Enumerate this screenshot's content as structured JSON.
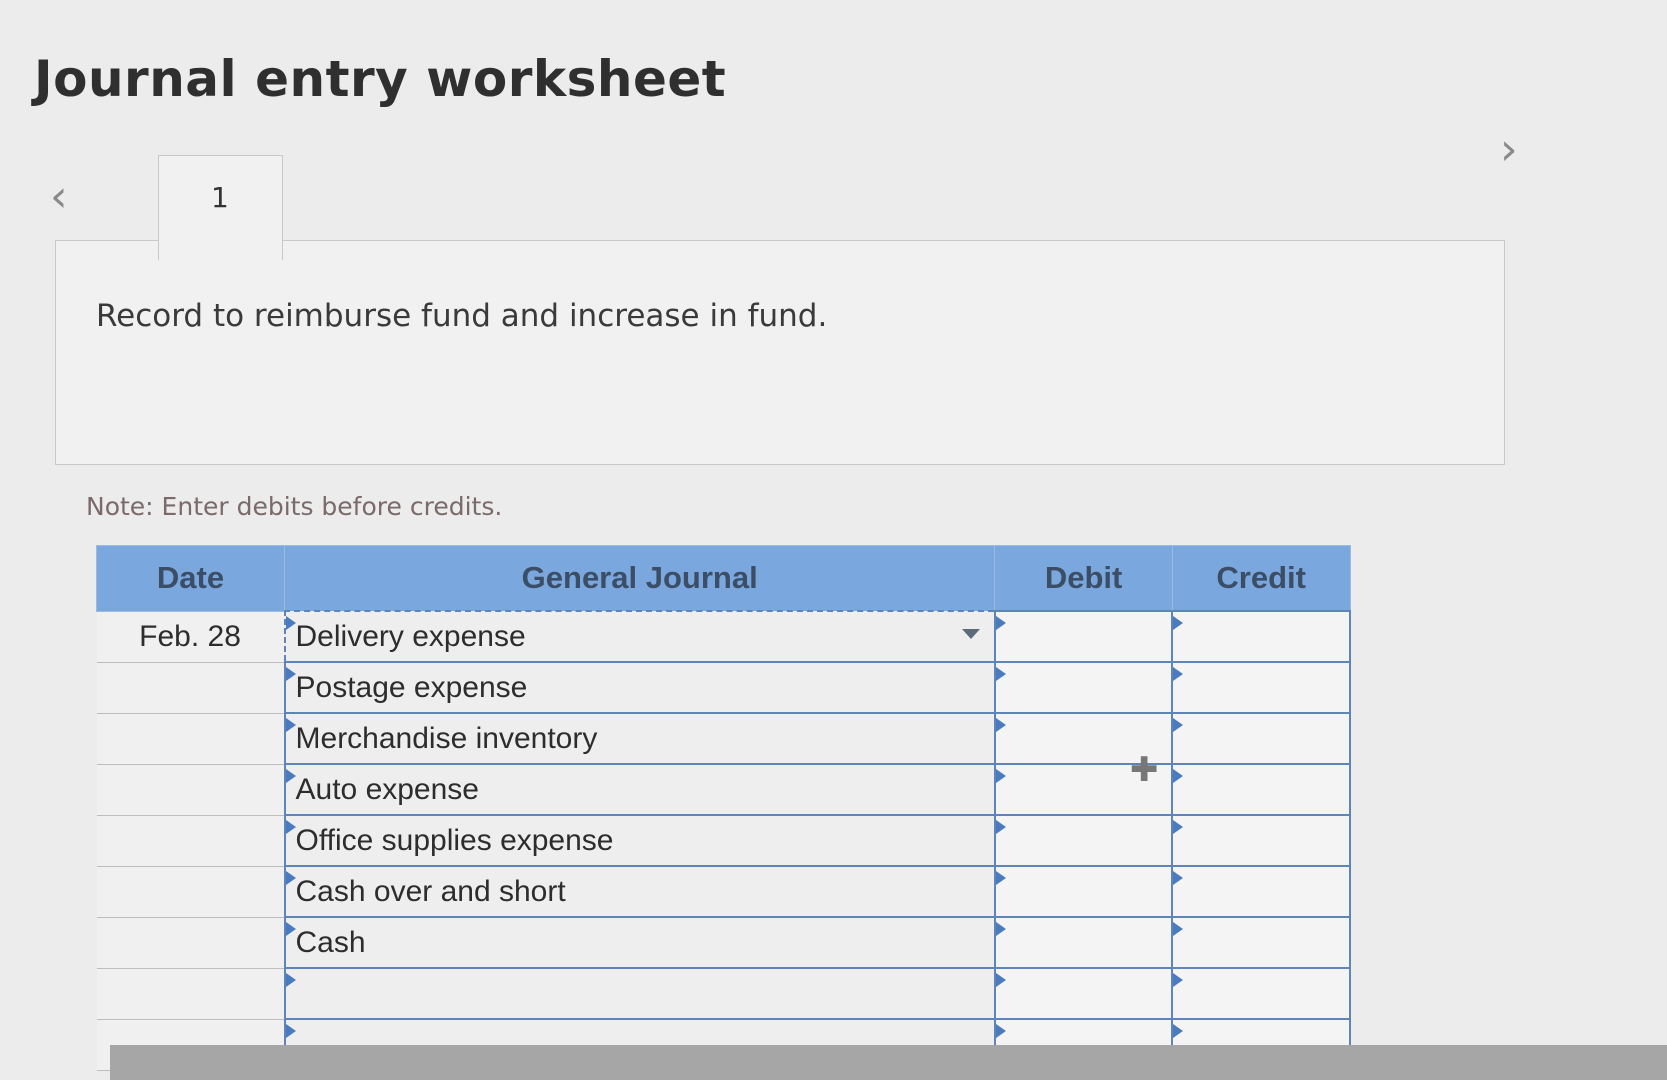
{
  "page": {
    "title": "Journal entry worksheet",
    "nav": {
      "prev_icon": "chevron-left-icon",
      "prev_glyph": "‹",
      "next_icon": "chevron-right-icon",
      "next_glyph": "›"
    },
    "tabs": [
      {
        "label": "1"
      }
    ],
    "instruction": "Record to reimburse fund and increase in fund.",
    "note": "Note: Enter debits before credits."
  },
  "journal": {
    "headers": {
      "date": "Date",
      "account": "General Journal",
      "debit": "Debit",
      "credit": "Credit"
    },
    "rows": [
      {
        "date": "Feb. 28",
        "account": "Delivery expense",
        "debit": "",
        "credit": ""
      },
      {
        "date": "",
        "account": "Postage expense",
        "debit": "",
        "credit": ""
      },
      {
        "date": "",
        "account": "Merchandise inventory",
        "debit": "",
        "credit": ""
      },
      {
        "date": "",
        "account": "Auto expense",
        "debit": "",
        "credit": ""
      },
      {
        "date": "",
        "account": "Office supplies expense",
        "debit": "",
        "credit": ""
      },
      {
        "date": "",
        "account": "Cash over and short",
        "debit": "",
        "credit": ""
      },
      {
        "date": "",
        "account": "Cash",
        "debit": "",
        "credit": ""
      },
      {
        "date": "",
        "account": "",
        "debit": "",
        "credit": ""
      },
      {
        "date": "",
        "account": "",
        "debit": "",
        "credit": ""
      }
    ]
  },
  "colors": {
    "header_blue": "#7aa8de",
    "border_blue": "#5e85b8"
  },
  "cursor_icon": "move-cursor-icon"
}
